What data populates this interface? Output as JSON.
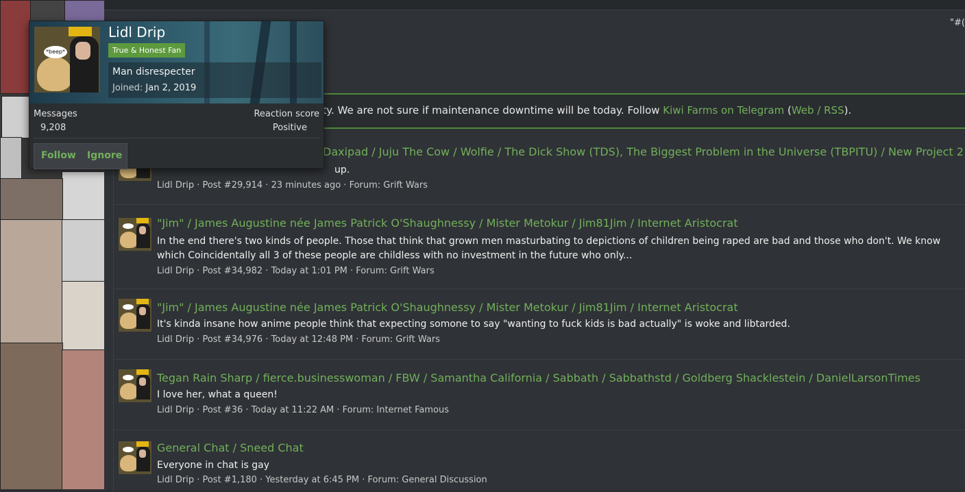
{
  "page": {
    "corner_text": "\"#("
  },
  "notice": {
    "text_prefix": "y be some instability. We are not sure if maintenance downtime will be today. Follow ",
    "link_telegram": "Kiwi Farms on Telegram",
    "open_paren": " (",
    "link_web_rss": "Web / RSS",
    "close_paren": ")."
  },
  "results": [
    {
      "title": "Daxipad / Juju The Cow / Wolfie / The Dick Show (TDS), The Biggest Problem in the Universe (TBPITU) / New Project 2",
      "snippet": "up.",
      "meta": "Lidl Drip · Post #29,914 · 23 minutes ago · Forum: Grift Wars"
    },
    {
      "title": "\"Jim\" / James Augustine née James Patrick O'Shaughnessy / Mister Metokur / Jim81Jim / Internet Aristocrat",
      "snippet": "In the end there's two kinds of people. Those that think that grown men masturbating to depictions of children being raped are bad and those who don't. We know which Coincidentally all 3 of these people are childless with no investment in the future who only...",
      "meta": "Lidl Drip · Post #34,982 · Today at 1:01 PM · Forum: Grift Wars"
    },
    {
      "title": "\"Jim\" / James Augustine née James Patrick O'Shaughnessy / Mister Metokur / Jim81Jim / Internet Aristocrat",
      "snippet": "It's kinda insane how anime people think that expecting somone to say \"wanting to fuck kids is bad actually\" is woke and libtarded.",
      "meta": "Lidl Drip · Post #34,976 · Today at 12:48 PM · Forum: Grift Wars"
    },
    {
      "title": "Tegan Rain Sharp / fierce.businesswoman / FBW / Samantha California / Sabbath / Sabbathstd / Goldberg Shacklestein / DanielLarsonTimes",
      "snippet": "I love her, what a queen!",
      "meta": "Lidl Drip · Post #36 · Today at 11:22 AM · Forum: Internet Famous"
    },
    {
      "title": "General Chat / Sneed Chat",
      "snippet": "Everyone in chat is gay",
      "meta": "Lidl Drip · Post #1,180 · Yesterday at 6:45 PM · Forum: General Discussion"
    }
  ],
  "popup": {
    "username": "Lidl Drip",
    "badge": "True & Honest Fan",
    "avatar_bubble": "*beep*",
    "custom_title": "Man disrespecter",
    "joined_label": "Joined:",
    "joined_value": "Jan 2, 2019",
    "messages_label": "Messages",
    "messages_value": "9,208",
    "reaction_label": "Reaction score",
    "reaction_value": "Positive",
    "follow_label": "Follow",
    "ignore_label": "Ignore"
  },
  "colors": {
    "link_green": "#72b05b",
    "badge_green": "#5d9a3e",
    "background": "#2f3236"
  }
}
